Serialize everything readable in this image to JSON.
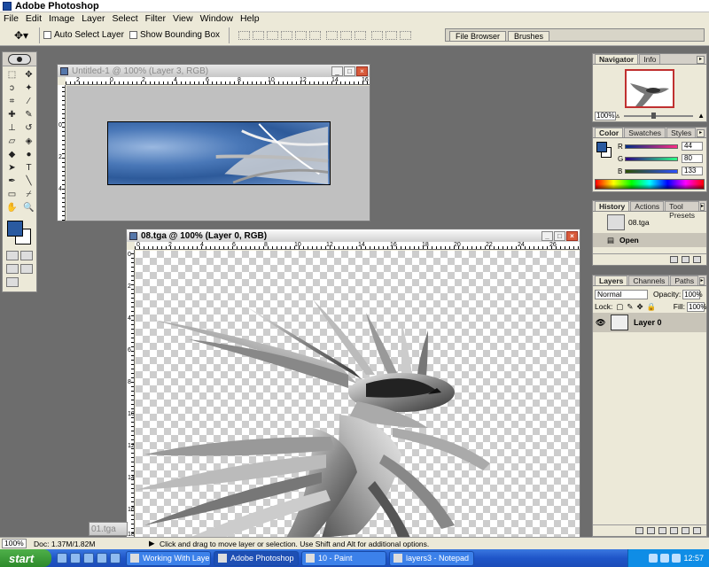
{
  "app": {
    "title": "Adobe Photoshop"
  },
  "menu": [
    "File",
    "Edit",
    "Image",
    "Layer",
    "Select",
    "Filter",
    "View",
    "Window",
    "Help"
  ],
  "options": {
    "auto_select_label": "Auto Select Layer",
    "bounding_box_label": "Show Bounding Box",
    "well_tabs": [
      "File Browser",
      "Brushes"
    ]
  },
  "doc1": {
    "title": "Untitled-1 @ 100% (Layer 3, RGB)",
    "ruler_h": [
      "2",
      "0",
      "2",
      "4",
      "6",
      "8",
      "10",
      "12",
      "14",
      "16"
    ],
    "ruler_v": [
      "0",
      "2",
      "4"
    ]
  },
  "doc2": {
    "title": "08.tga @ 100% (Layer 0, RGB)",
    "ruler_h": [
      "0",
      "2",
      "4",
      "6",
      "8",
      "10",
      "12",
      "14",
      "16",
      "18",
      "20",
      "22",
      "24",
      "26"
    ],
    "ruler_v": [
      "0",
      "2",
      "4",
      "6",
      "8",
      "10",
      "12",
      "14",
      "16",
      "18"
    ]
  },
  "minimized_doc": "01.tga",
  "navigator": {
    "tabs": [
      "Navigator",
      "Info"
    ],
    "zoom": "100%"
  },
  "color_panel": {
    "tabs": [
      "Color",
      "Swatches",
      "Styles"
    ],
    "fg": "#2a5aa0",
    "rows": [
      {
        "label": "R",
        "value": "44",
        "gradient": "linear-gradient(90deg,#002c85,#ff2c85)"
      },
      {
        "label": "G",
        "value": "80",
        "gradient": "linear-gradient(90deg,#2c0085,#2cff85)"
      },
      {
        "label": "B",
        "value": "133",
        "gradient": "linear-gradient(90deg,#2c5000,#2c50ff)"
      }
    ]
  },
  "history": {
    "tabs": [
      "History",
      "Actions",
      "Tool Presets"
    ],
    "snapshot": "08.tga",
    "state": "Open"
  },
  "layers": {
    "tabs": [
      "Layers",
      "Channels",
      "Paths"
    ],
    "blend": "Normal",
    "opacity_label": "Opacity:",
    "opacity": "100%",
    "lock_label": "Lock:",
    "fill_label": "Fill:",
    "fill": "100%",
    "layer_name": "Layer 0"
  },
  "status": {
    "zoom": "100%",
    "doc": "Doc: 1.37M/1.82M",
    "hint": "Click and drag to move layer or selection.  Use Shift and Alt for additional options."
  },
  "taskbar": {
    "start": "start",
    "tasks": [
      "Working With Layers ...",
      "Adobe Photoshop",
      "10 - Paint",
      "layers3 - Notepad"
    ],
    "clock": "12:57"
  }
}
